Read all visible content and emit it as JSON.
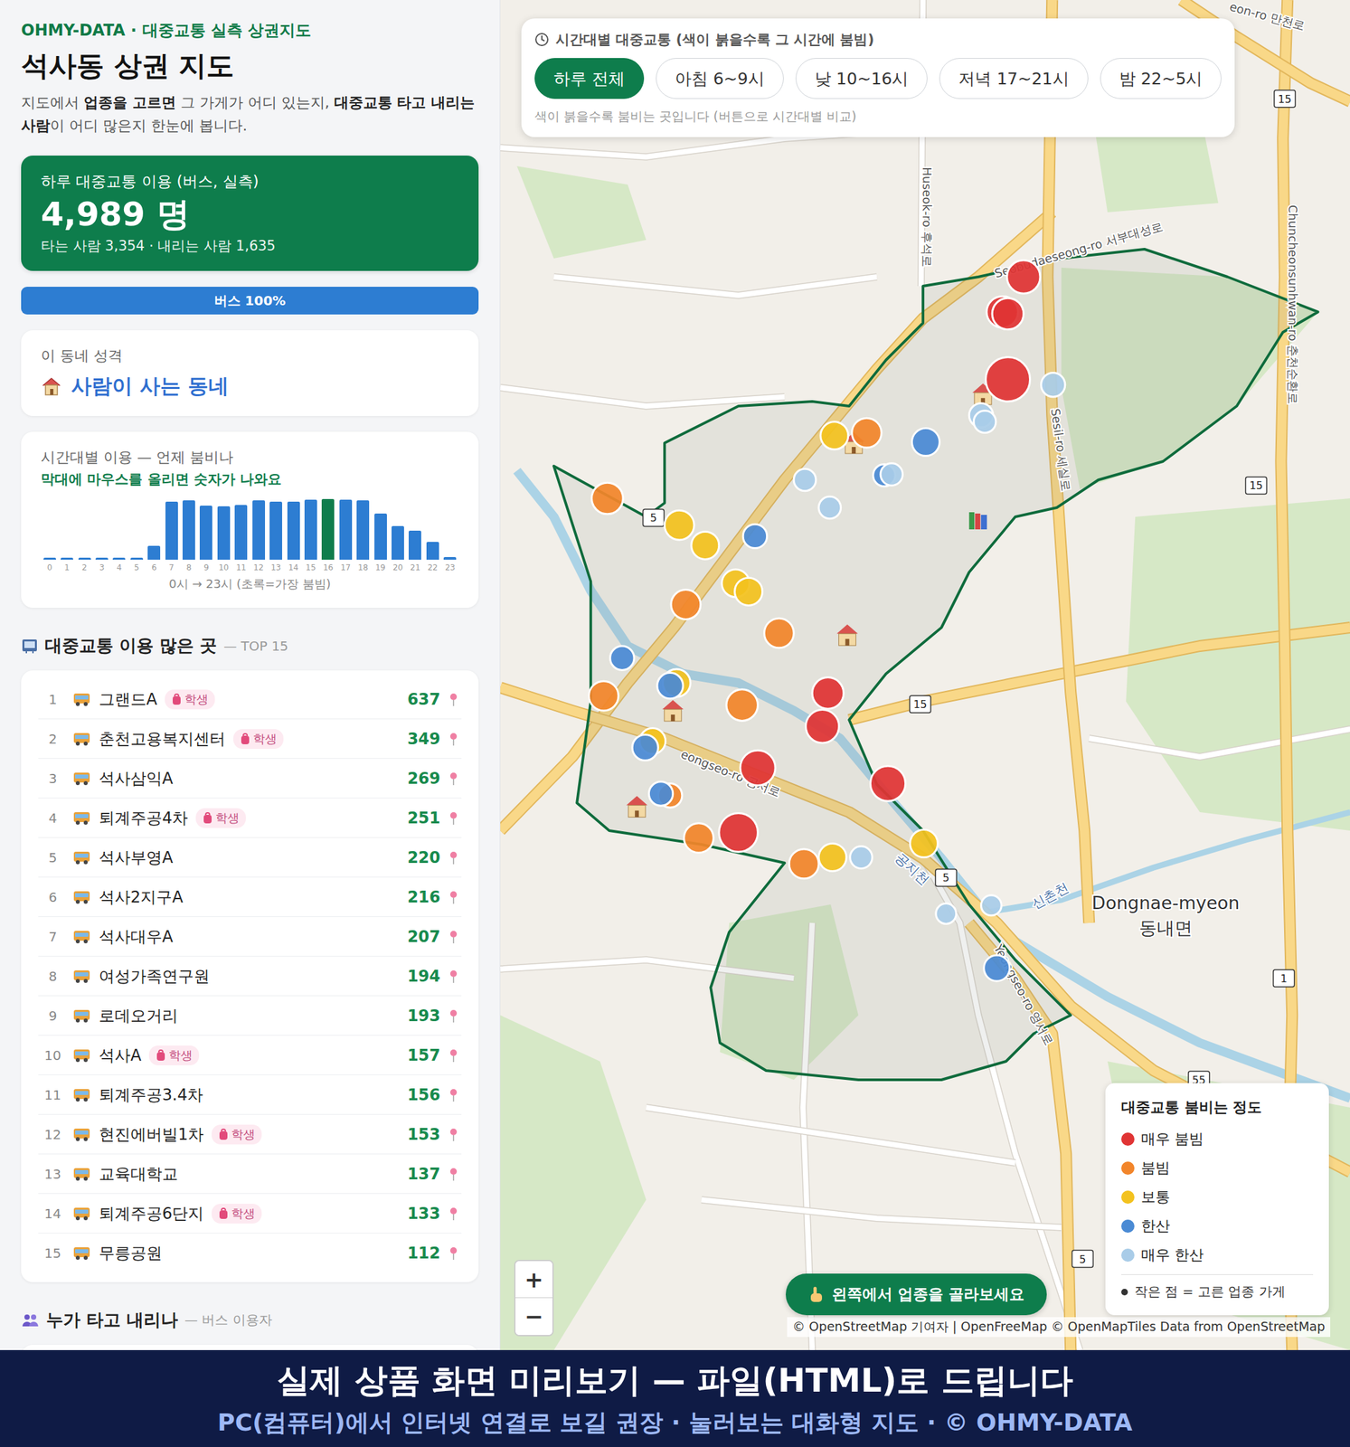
{
  "brand": "OHMY-DATA · 대중교통 실측 상권지도",
  "title": "석사동 상권 지도",
  "intro": [
    {
      "text": "지도에서 ",
      "bold": false
    },
    {
      "text": "업종을 고르면",
      "bold": true
    },
    {
      "text": " 그 가게가 어디 있는지, ",
      "bold": false
    },
    {
      "text": "대중교통 타고 내리는 사람",
      "bold": true
    },
    {
      "text": "이 어디 많은지 한눈에 봅니다.",
      "bold": false
    }
  ],
  "summary": {
    "label": "하루 대중교통 이용 (버스, 실측)",
    "value": "4,989 명",
    "detail": "타는 사람 3,354 · 내리는 사람 1,635"
  },
  "modes": [
    {
      "label": "버스 100%",
      "level": 1,
      "color": "#2d7dd2"
    }
  ],
  "character": {
    "label": "이 동네 성격",
    "value": "사람이 사는 동네"
  },
  "hourly": {
    "title": "시간대별 이용 — 언제 붐비나",
    "hint": "막대에 마우스를 올리면 숫자가 나와요",
    "ticks": [
      "0",
      "1",
      "2",
      "3",
      "4",
      "5",
      "6",
      "7",
      "8",
      "9",
      "10",
      "11",
      "12",
      "13",
      "14",
      "15",
      "16",
      "17",
      "18",
      "19",
      "20",
      "21",
      "22",
      "23"
    ],
    "values": [
      12,
      10,
      9,
      8,
      10,
      14,
      82,
      338,
      347,
      316,
      311,
      318,
      346,
      338,
      339,
      349,
      352,
      348,
      345,
      268,
      197,
      170,
      104,
      15
    ],
    "peak": 16,
    "caption": "0시 → 23시 (초록=가장 붐빔)"
  },
  "top_stops": {
    "title": "대중교통 이용 많은 곳",
    "subtitle": "— TOP 15",
    "badge_label": "학생",
    "rows": [
      {
        "rank": "1",
        "name": "그랜드A",
        "student": true,
        "count": "637"
      },
      {
        "rank": "2",
        "name": "춘천고용복지센터",
        "student": true,
        "count": "349"
      },
      {
        "rank": "3",
        "name": "석사삼익A",
        "student": false,
        "count": "269"
      },
      {
        "rank": "4",
        "name": "퇴계주공4차",
        "student": true,
        "count": "251"
      },
      {
        "rank": "5",
        "name": "석사부영A",
        "student": false,
        "count": "220"
      },
      {
        "rank": "6",
        "name": "석사2지구A",
        "student": false,
        "count": "216"
      },
      {
        "rank": "7",
        "name": "석사대우A",
        "student": false,
        "count": "207"
      },
      {
        "rank": "8",
        "name": "여성가족연구원",
        "student": false,
        "count": "194"
      },
      {
        "rank": "9",
        "name": "로데오거리",
        "student": false,
        "count": "193"
      },
      {
        "rank": "10",
        "name": "석사A",
        "student": true,
        "count": "157"
      },
      {
        "rank": "11",
        "name": "퇴계주공3.4차",
        "student": false,
        "count": "156"
      },
      {
        "rank": "12",
        "name": "현진에버빌1차",
        "student": true,
        "count": "153"
      },
      {
        "rank": "13",
        "name": "교육대학교",
        "student": false,
        "count": "137"
      },
      {
        "rank": "14",
        "name": "퇴계주공6단지",
        "student": true,
        "count": "133"
      },
      {
        "rank": "15",
        "name": "무릉공원",
        "student": false,
        "count": "112"
      }
    ]
  },
  "riders": {
    "title": "누가 타고 내리나",
    "subtitle": "— 버스 이용자"
  },
  "map": {
    "time_filter": {
      "title": "시간대별 대중교통 (색이 붉을수록 그 시간에 붐빔)",
      "options": [
        {
          "label": "하루 전체",
          "selected": true
        },
        {
          "label": "아침 6~9시",
          "selected": false
        },
        {
          "label": "낮 10~16시",
          "selected": false
        },
        {
          "label": "저녁 17~21시",
          "selected": false
        },
        {
          "label": "밤 22~5시",
          "selected": false
        }
      ],
      "hint": "색이 붉을수록 붐비는 곳입니다 (버튼으로 시간대별 비교)"
    },
    "legend": {
      "title": "대중교통 붐비는 정도",
      "items": [
        {
          "label": "매우 붐빔",
          "color": "#e03434"
        },
        {
          "label": "붐빔",
          "color": "#f2852a"
        },
        {
          "label": "보통",
          "color": "#f3c21e"
        },
        {
          "label": "한산",
          "color": "#4a8ad4"
        },
        {
          "label": "매우 한산",
          "color": "#a9cce8"
        }
      ],
      "note": "작은 점 = 고른 업종 가게"
    },
    "zoom": [
      "+",
      "−"
    ],
    "callout": "왼쪽에서 업종을 골라보세요",
    "attribution": "© OpenStreetMap 기여자 | OpenFreeMap © OpenMapTiles Data from OpenStreetMap",
    "labels": [
      "Dongnae-myeon",
      "동내면",
      "Huseok-ro 후석로",
      "Sesil-ro 세실로",
      "Chuncheonsunhwan-ro 춘천순환로",
      "Seobudaeseong-ro 서부대성로",
      "eongseo-ro 공서로",
      "공지천",
      "신촌천",
      "Yeongseo-ro 영서로",
      "eon-ro 만천로"
    ],
    "shields": [
      "15",
      "15",
      "15",
      "5",
      "5",
      "1",
      "55",
      "5"
    ],
    "stops": [
      {
        "color": "#e03434"
      },
      {
        "color": "#e03434"
      },
      {
        "color": "#e03434"
      },
      {
        "color": "#e03434"
      },
      {
        "color": "#a9cce8"
      },
      {
        "color": "#a9cce8"
      },
      {
        "color": "#a9cce8"
      },
      {
        "color": "#4a8ad4"
      },
      {
        "color": "#f2852a"
      },
      {
        "color": "#f3c21e"
      },
      {
        "color": "#4a8ad4"
      },
      {
        "color": "#a9cce8"
      },
      {
        "color": "#a9cce8"
      },
      {
        "color": "#a9cce8"
      },
      {
        "color": "#4a8ad4"
      },
      {
        "color": "#f2852a"
      },
      {
        "color": "#f3c21e"
      },
      {
        "color": "#f3c21e"
      },
      {
        "color": "#f3c21e"
      },
      {
        "color": "#f3c21e"
      },
      {
        "color": "#f2852a"
      },
      {
        "color": "#f2852a"
      },
      {
        "color": "#4a8ad4"
      },
      {
        "color": "#f3c21e"
      },
      {
        "color": "#4a8ad4"
      },
      {
        "color": "#f2852a"
      },
      {
        "color": "#f2852a"
      },
      {
        "color": "#e03434"
      },
      {
        "color": "#e03434"
      },
      {
        "color": "#f3c21e"
      },
      {
        "color": "#4a8ad4"
      },
      {
        "color": "#e03434"
      },
      {
        "color": "#e03434"
      },
      {
        "color": "#f2852a"
      },
      {
        "color": "#4a8ad4"
      },
      {
        "color": "#e03434"
      },
      {
        "color": "#f2852a"
      },
      {
        "color": "#f2852a"
      },
      {
        "color": "#f3c21e"
      },
      {
        "color": "#a9cce8"
      },
      {
        "color": "#f3c21e"
      },
      {
        "color": "#a9cce8"
      },
      {
        "color": "#a9cce8"
      },
      {
        "color": "#4a8ad4"
      }
    ]
  },
  "banner": {
    "main": "실제 상품 화면 미리보기 — 파일(HTML)로 드립니다",
    "sub": "PC(컴퓨터)에서 인터넷 연결로 보길 권장 · 눌러보는 대화형 지도 · © OHMY-DATA"
  }
}
